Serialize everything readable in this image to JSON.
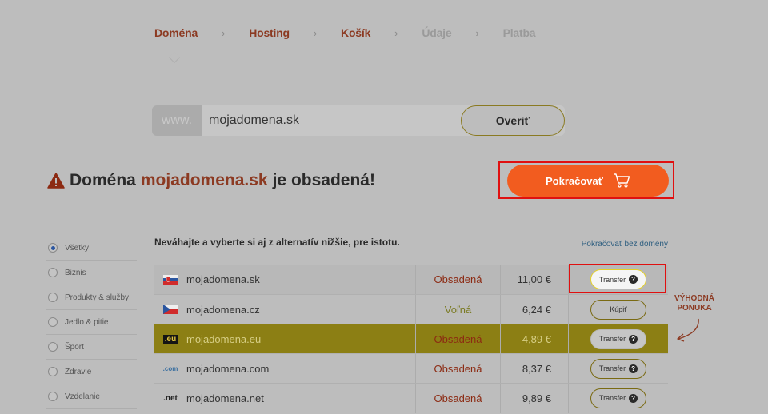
{
  "stepper": {
    "steps": [
      {
        "label": "Doména"
      },
      {
        "label": "Hosting"
      },
      {
        "label": "Košík"
      },
      {
        "label": "Údaje"
      },
      {
        "label": "Platba"
      }
    ],
    "separator": "›"
  },
  "search": {
    "prefix": "www.",
    "value": "mojadomena.sk",
    "verify_label": "Overiť"
  },
  "headline": {
    "prefix": "Doména",
    "domain": "mojadomena.sk",
    "suffix": "je obsadená!"
  },
  "continue_label": "Pokračovať",
  "categories": [
    {
      "label": "Všetky",
      "selected": true
    },
    {
      "label": "Biznis",
      "selected": false
    },
    {
      "label": "Produkty & služby",
      "selected": false
    },
    {
      "label": "Jedlo & pitie",
      "selected": false
    },
    {
      "label": "Šport",
      "selected": false
    },
    {
      "label": "Zdravie",
      "selected": false
    },
    {
      "label": "Vzdelanie",
      "selected": false
    }
  ],
  "list": {
    "hint": "Neváhajte a vyberte si aj z alternatív nižšie, pre istotu.",
    "continue_without": "Pokračovať bez domény",
    "rows": [
      {
        "tld": "sk",
        "name": "mojadomena.sk",
        "status": "Obsadená",
        "price": "11,00 €",
        "action": "Transfer"
      },
      {
        "tld": "cz",
        "name": "mojadomena.cz",
        "status": "Voľná",
        "price": "6,24 €",
        "action": "Kúpiť"
      },
      {
        "tld": ".eu",
        "name": "mojadomena.eu",
        "status": "Obsadená",
        "price": "4,89 €",
        "action": "Transfer"
      },
      {
        "tld": ".com",
        "name": "mojadomena.com",
        "status": "Obsadená",
        "price": "8,37 €",
        "action": "Transfer"
      },
      {
        "tld": ".net",
        "name": "mojadomena.net",
        "status": "Obsadená",
        "price": "9,89 €",
        "action": "Transfer"
      }
    ]
  },
  "promo": {
    "line1": "VÝHODNÁ",
    "line2": "PONUKA"
  },
  "colors": {
    "accent": "#f25c1f",
    "brand_dark": "#8c3a22",
    "highlight_row": "#8c7f14",
    "annotation": "#e01010"
  }
}
